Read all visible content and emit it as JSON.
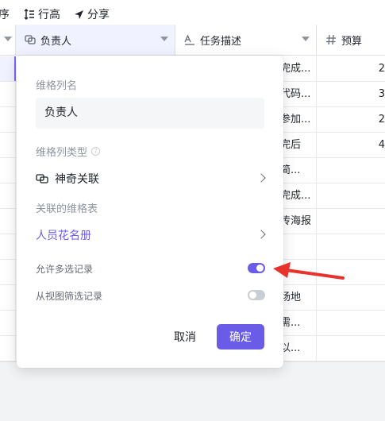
{
  "toolbar": {
    "sort_label": "序",
    "row_height_label": "行高",
    "share_label": "分享"
  },
  "columns": {
    "owner": "负责人",
    "task_desc": "任务描述",
    "budget": "预算"
  },
  "rows": [
    {
      "desc": "完成...",
      "budget": "2"
    },
    {
      "desc": "代码...",
      "budget": "3"
    },
    {
      "desc": "参加...",
      "budget": "2"
    },
    {
      "desc": "完后",
      "budget": "4"
    },
    {
      "desc": "简...",
      "budget": ""
    },
    {
      "desc": "完成...",
      "budget": ""
    },
    {
      "desc": "传海报",
      "budget": ""
    },
    {
      "desc": "",
      "budget": ""
    },
    {
      "desc": "",
      "budget": ""
    },
    {
      "desc": "场地",
      "budget": ""
    },
    {
      "desc": "需...",
      "budget": ""
    },
    {
      "desc": "以...",
      "budget": ""
    }
  ],
  "panel": {
    "name_label": "维格列名",
    "name_value": "负责人",
    "type_label": "维格列类型",
    "type_value": "神奇关联",
    "linked_label": "关联的维格表",
    "linked_value": "人员花名册",
    "multi_select_label": "允许多选记录",
    "multi_select_on": true,
    "filter_label": "从视图筛选记录",
    "filter_on": false,
    "cancel_label": "取消",
    "confirm_label": "确定",
    "help_glyph": "?"
  },
  "colors": {
    "accent": "#6b5ce7",
    "arrow": "#e8322b"
  }
}
